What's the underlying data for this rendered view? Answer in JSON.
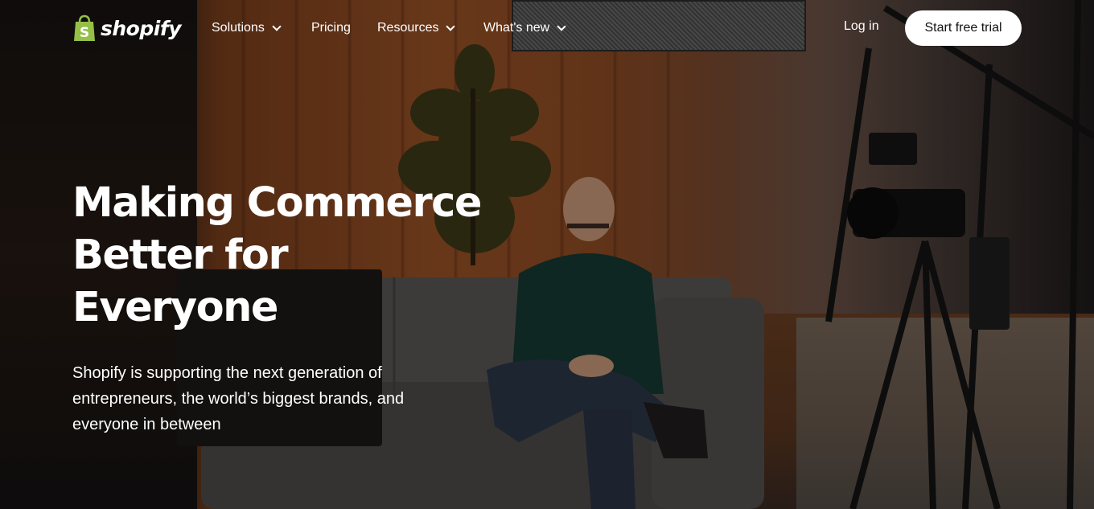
{
  "brand": {
    "name": "shopify",
    "logo_icon": "shopping-bag-icon",
    "accent_color": "#95BF47"
  },
  "nav": {
    "items": [
      {
        "label": "Solutions",
        "has_dropdown": true
      },
      {
        "label": "Pricing",
        "has_dropdown": false
      },
      {
        "label": "Resources",
        "has_dropdown": true
      },
      {
        "label": "What's new",
        "has_dropdown": true
      }
    ],
    "login_label": "Log in",
    "cta_label": "Start free trial"
  },
  "hero": {
    "headline_lines": [
      "Making Commerce",
      "Better for",
      "Everyone"
    ],
    "subcopy_lines": [
      "Shopify is supporting the next generation of",
      "entrepreneurs, the world’s biggest brands, and",
      "everyone in between"
    ]
  }
}
